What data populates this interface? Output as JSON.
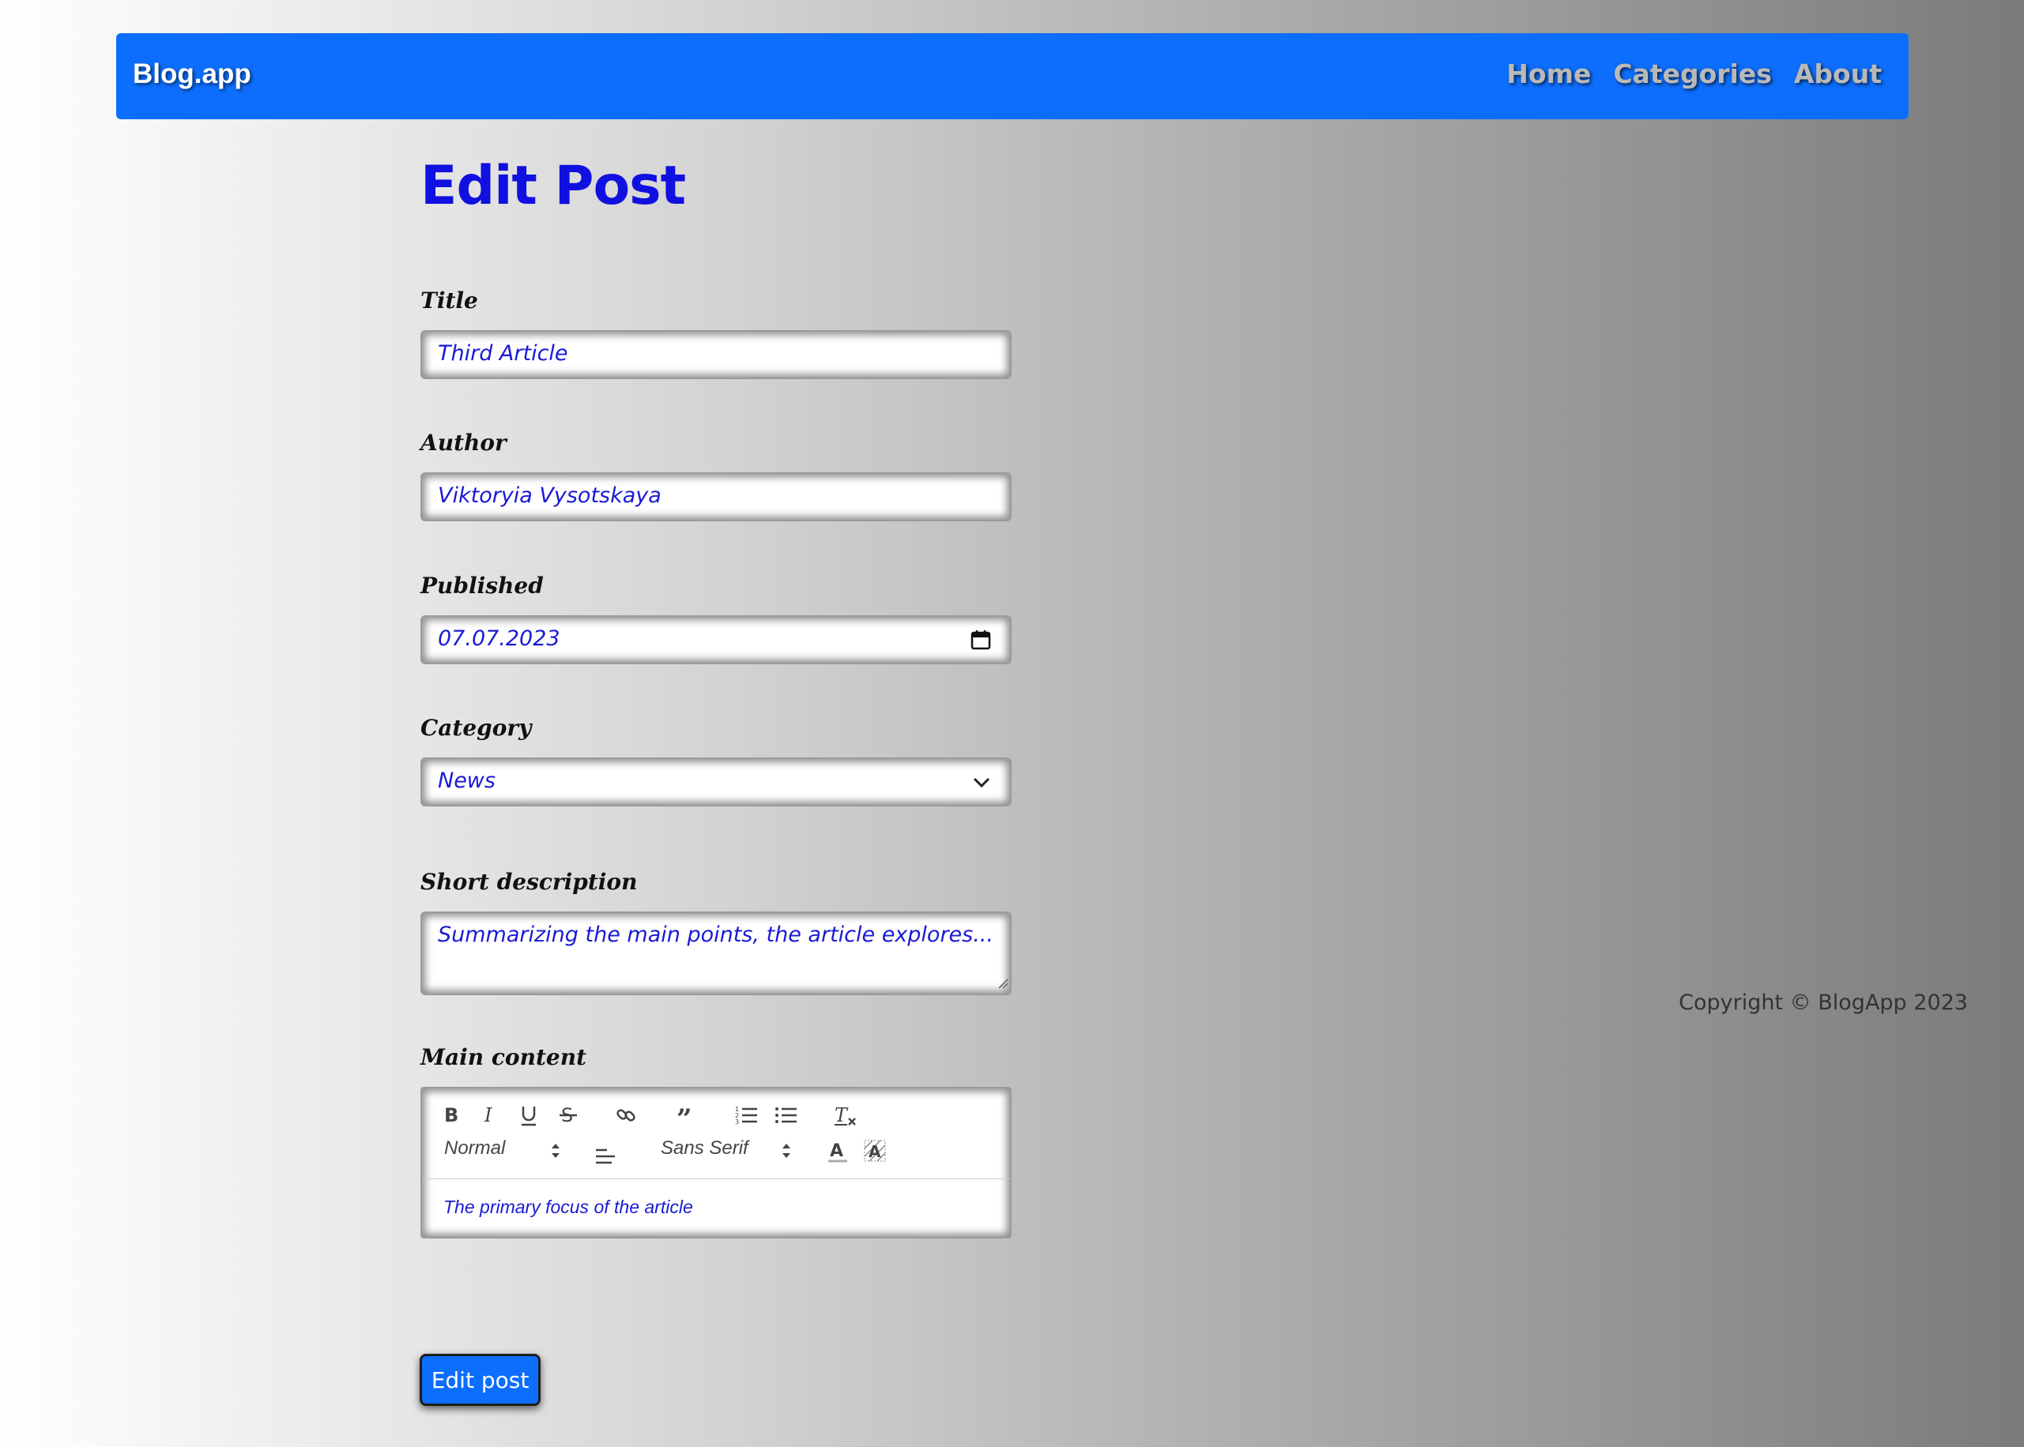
{
  "navbar": {
    "brand": "Blog.app",
    "links": [
      "Home",
      "Categories",
      "About"
    ]
  },
  "page": {
    "title": "Edit Post"
  },
  "form": {
    "title": {
      "label": "Title",
      "value": "Third Article"
    },
    "author": {
      "label": "Author",
      "value": "Viktoryia Vysotskaya"
    },
    "published": {
      "label": "Published",
      "value": "07.07.2023"
    },
    "category": {
      "label": "Category",
      "value": "News"
    },
    "short_description": {
      "label": "Short description",
      "value": "Summarizing the main points, the article explores..."
    },
    "main_content": {
      "label": "Main content",
      "toolbar": {
        "header_select": "Normal",
        "font_select": "Sans Serif"
      },
      "value": "The primary focus of the article"
    },
    "submit_label": "Edit post"
  },
  "footer": {
    "copyright": "Copyright © BlogApp 2023"
  },
  "colors": {
    "primary": "#0d6efd",
    "heading": "#1010e0",
    "value_text": "#1a1ad6"
  }
}
